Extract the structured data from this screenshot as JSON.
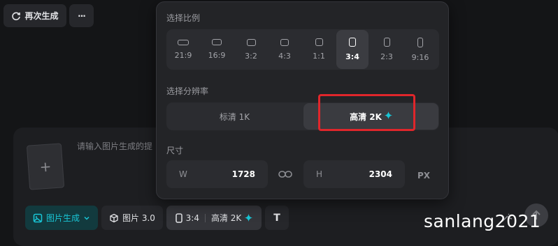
{
  "header": {
    "regenerate_label": "再次生成",
    "more_label": "···"
  },
  "composer": {
    "placeholder": "请输入图片生成的提",
    "upload_plus": "+"
  },
  "popover": {
    "ratio_title": "选择比例",
    "ratios": [
      {
        "label": "21:9",
        "selected": false
      },
      {
        "label": "16:9",
        "selected": false
      },
      {
        "label": "3:2",
        "selected": false
      },
      {
        "label": "4:3",
        "selected": false
      },
      {
        "label": "1:1",
        "selected": false
      },
      {
        "label": "3:4",
        "selected": true
      },
      {
        "label": "2:3",
        "selected": false
      },
      {
        "label": "9:16",
        "selected": false
      }
    ],
    "resolution_title": "选择分辨率",
    "resolutions": [
      {
        "label": "标清 1K",
        "selected": false
      },
      {
        "label": "高清 2K",
        "selected": true
      }
    ],
    "size_title": "尺寸",
    "width_key": "W",
    "width_value": "1728",
    "height_key": "H",
    "height_value": "2304",
    "unit": "PX"
  },
  "toolbar": {
    "mode_label": "图片生成",
    "model_label": "图片 3.0",
    "ratio_label": "3:4",
    "resolution_label": "高清 2K",
    "text_tool_label": "T"
  },
  "watermark": "sanlang2021",
  "colors": {
    "accent": "#19c6d6",
    "highlight_box": "#e0262b",
    "mode_button_bg": "#123a3e"
  }
}
